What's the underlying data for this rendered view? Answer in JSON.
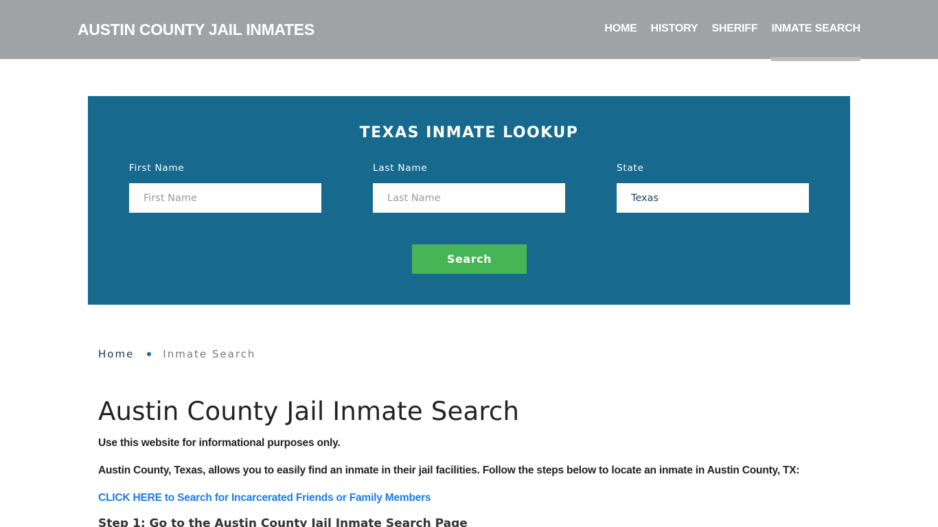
{
  "header": {
    "brand": "AUSTIN COUNTY JAIL INMATES",
    "nav": [
      {
        "label": "HOME",
        "active": false
      },
      {
        "label": "HISTORY",
        "active": false
      },
      {
        "label": "SHERIFF",
        "active": false
      },
      {
        "label": "INMATE SEARCH",
        "active": true
      }
    ]
  },
  "lookup": {
    "title": "TEXAS INMATE LOOKUP",
    "first_name": {
      "label": "First Name",
      "placeholder": "First Name",
      "value": ""
    },
    "last_name": {
      "label": "Last Name",
      "placeholder": "Last Name",
      "value": ""
    },
    "state": {
      "label": "State",
      "value": "Texas"
    },
    "search_label": "Search"
  },
  "breadcrumb": {
    "home": "Home",
    "current": "Inmate Search"
  },
  "content": {
    "title": "Austin County Jail Inmate Search",
    "disclaimer": "Use this website for informational purposes only.",
    "intro": "Austin County, Texas, allows you to easily find an inmate in their jail facilities. Follow the steps below to locate an inmate in Austin County, TX:",
    "cta_link": "CLICK HERE to Search for Incarcerated Friends or Family Members",
    "step1": "Step 1: Go to the Austin County Jail Inmate Search Page"
  },
  "colors": {
    "header_bg": "#9fa3a6",
    "lookup_bg": "#176a8d",
    "search_button": "#45b556",
    "link": "#1b7ce8"
  }
}
